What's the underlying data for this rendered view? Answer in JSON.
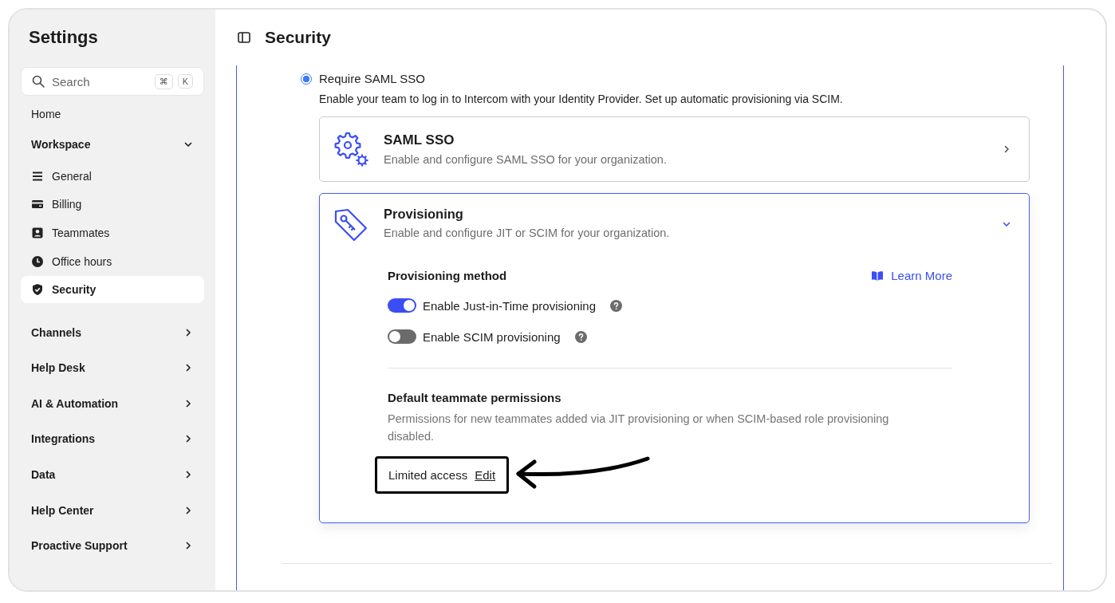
{
  "sidebar": {
    "title": "Settings",
    "search": {
      "placeholder": "Search",
      "shortcut_keys": [
        "⌘",
        "K"
      ]
    },
    "items": [
      {
        "label": "Home",
        "kind": "link"
      },
      {
        "label": "Workspace",
        "kind": "group",
        "expanded": true,
        "children": [
          {
            "label": "General",
            "selected": false
          },
          {
            "label": "Billing",
            "selected": false
          },
          {
            "label": "Teammates",
            "selected": false
          },
          {
            "label": "Office hours",
            "selected": false
          },
          {
            "label": "Security",
            "selected": true
          }
        ]
      },
      {
        "label": "Channels",
        "kind": "group",
        "expanded": false
      },
      {
        "label": "Help Desk",
        "kind": "group",
        "expanded": false
      },
      {
        "label": "AI & Automation",
        "kind": "group",
        "expanded": false
      },
      {
        "label": "Integrations",
        "kind": "group",
        "expanded": false
      },
      {
        "label": "Data",
        "kind": "group",
        "expanded": false
      },
      {
        "label": "Help Center",
        "kind": "group",
        "expanded": false
      },
      {
        "label": "Proactive Support",
        "kind": "group",
        "expanded": false
      }
    ]
  },
  "page_title": "Security",
  "sso_option": {
    "label": "Require SAML SSO",
    "selected": true,
    "description": "Enable your team to log in to Intercom with your Identity Provider. Set up automatic provisioning via SCIM."
  },
  "cards": [
    {
      "kind": "saml",
      "title": "SAML SSO",
      "description": "Enable and configure SAML SSO for your organization.",
      "expanded": false
    },
    {
      "kind": "provisioning",
      "title": "Provisioning",
      "description": "Enable and configure JIT or SCIM for your organization.",
      "expanded": true
    }
  ],
  "provisioning": {
    "method_heading": "Provisioning method",
    "learn_more": "Learn More",
    "toggles": [
      {
        "label": "Enable Just-in-Time provisioning",
        "on": true
      },
      {
        "label": "Enable SCIM provisioning",
        "on": false
      }
    ],
    "permissions": {
      "heading": "Default teammate permissions",
      "description": "Permissions for new teammates added via JIT provisioning or when SCIM-based role provisioning disabled.",
      "value": "Limited access",
      "edit": "Edit",
      "highlighted": true
    }
  }
}
